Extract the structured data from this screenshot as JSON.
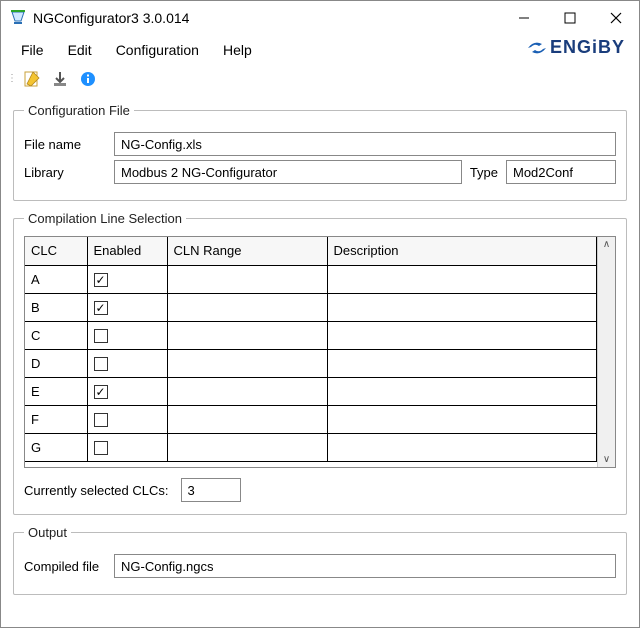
{
  "window": {
    "title": "NGConfigurator3 3.0.014"
  },
  "menu": {
    "file": "File",
    "edit": "Edit",
    "configuration": "Configuration",
    "help": "Help"
  },
  "brand": "ENGiBY",
  "config_file": {
    "legend": "Configuration File",
    "file_name_label": "File name",
    "file_name_value": "NG-Config.xls",
    "library_label": "Library",
    "library_value": "Modbus 2 NG-Configurator",
    "type_label": "Type",
    "type_value": "Mod2Conf"
  },
  "clc": {
    "legend": "Compilation Line Selection",
    "headers": {
      "clc": "CLC",
      "enabled": "Enabled",
      "range": "CLN Range",
      "description": "Description"
    },
    "rows": [
      {
        "clc": "A",
        "enabled": true,
        "range": "",
        "description": ""
      },
      {
        "clc": "B",
        "enabled": true,
        "range": "",
        "description": ""
      },
      {
        "clc": "C",
        "enabled": false,
        "range": "",
        "description": ""
      },
      {
        "clc": "D",
        "enabled": false,
        "range": "",
        "description": ""
      },
      {
        "clc": "E",
        "enabled": true,
        "range": "",
        "description": ""
      },
      {
        "clc": "F",
        "enabled": false,
        "range": "",
        "description": ""
      },
      {
        "clc": "G",
        "enabled": false,
        "range": "",
        "description": ""
      }
    ],
    "count_label": "Currently selected CLCs:",
    "count_value": "3"
  },
  "output": {
    "legend": "Output",
    "compiled_label": "Compiled file",
    "compiled_value": "NG-Config.ngcs"
  }
}
